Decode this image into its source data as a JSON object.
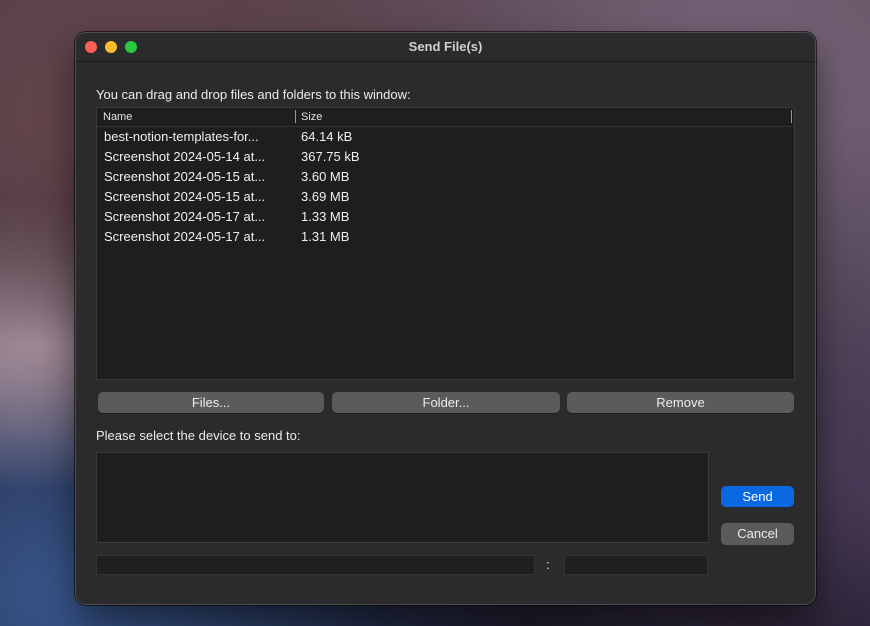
{
  "window": {
    "title": "Send File(s)"
  },
  "files": {
    "instruction": "You can drag and drop files and folders to this window:",
    "columns": {
      "name": "Name",
      "size": "Size"
    },
    "rows": [
      {
        "name": "best-notion-templates-for...",
        "size": "64.14 kB"
      },
      {
        "name": "Screenshot 2024-05-14 at...",
        "size": "367.75 kB"
      },
      {
        "name": "Screenshot 2024-05-15 at...",
        "size": "3.60 MB"
      },
      {
        "name": "Screenshot 2024-05-15 at...",
        "size": "3.69 MB"
      },
      {
        "name": "Screenshot 2024-05-17 at...",
        "size": "1.33 MB"
      },
      {
        "name": "Screenshot 2024-05-17 at...",
        "size": "1.31 MB"
      }
    ],
    "buttons": {
      "files": "Files...",
      "folder": "Folder...",
      "remove": "Remove"
    }
  },
  "device": {
    "instruction": "Please select the device to send to:",
    "separator": ":",
    "host_value": "",
    "port_value": ""
  },
  "actions": {
    "send": "Send",
    "cancel": "Cancel"
  },
  "colors": {
    "accent": "#0a68e0",
    "window_bg": "#2b2b2d",
    "list_bg": "#1e1e1e"
  }
}
